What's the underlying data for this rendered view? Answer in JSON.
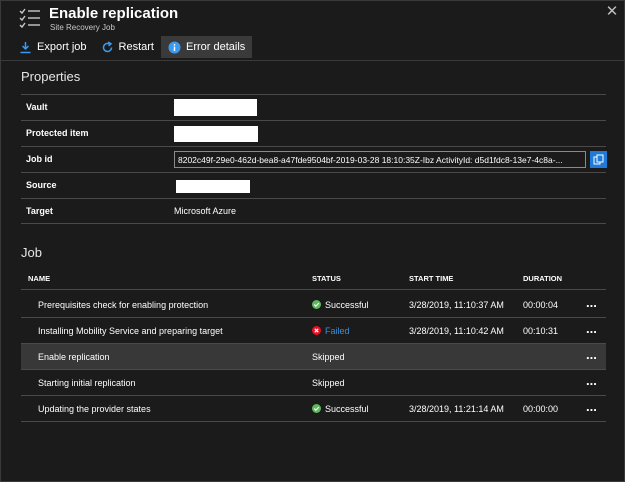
{
  "header": {
    "title": "Enable replication",
    "subtitle": "Site Recovery Job",
    "icon": "checklist-icon",
    "close_icon": "close-icon"
  },
  "toolbar": {
    "export_label": "Export job",
    "restart_label": "Restart",
    "error_details_label": "Error details",
    "active_color": "#3a3a3a"
  },
  "properties": {
    "title": "Properties",
    "rows": [
      {
        "label": "Vault",
        "value": ""
      },
      {
        "label": "Protected item",
        "value": ""
      },
      {
        "label": "Job id",
        "value": "8202c49f-29e0-462d-bea8-a47fde9504bf-2019-03-28 18:10:35Z-Ibz ActivityId: d5d1fdc8-13e7-4c8a-..."
      },
      {
        "label": "Source",
        "value": ""
      },
      {
        "label": "Target",
        "value": "Microsoft Azure"
      }
    ]
  },
  "job": {
    "title": "Job",
    "columns": {
      "name": "NAME",
      "status": "STATUS",
      "start_time": "START TIME",
      "duration": "DURATION"
    },
    "rows": [
      {
        "name": "Prerequisites check for enabling protection",
        "status": "Successful",
        "start_time": "3/28/2019, 11:10:37 AM",
        "duration": "00:00:04",
        "more": "..."
      },
      {
        "name": "Installing Mobility Service and preparing target",
        "status": "Failed",
        "start_time": "3/28/2019, 11:10:42 AM",
        "duration": "00:10:31",
        "more": "..."
      },
      {
        "name": "Enable replication",
        "status": "Skipped",
        "start_time": "",
        "duration": "",
        "more": "..."
      },
      {
        "name": "Starting initial replication",
        "status": "Skipped",
        "start_time": "",
        "duration": "",
        "more": "..."
      },
      {
        "name": "Updating the provider states",
        "status": "Successful",
        "start_time": "3/28/2019, 11:21:14 AM",
        "duration": "00:00:00",
        "more": "..."
      }
    ]
  },
  "colors": {
    "background": "#1b1b1b",
    "success": "#5cb85c",
    "failed": "#e81123",
    "failed_text": "#3a8fd8",
    "accent": "#1e7bd8"
  }
}
